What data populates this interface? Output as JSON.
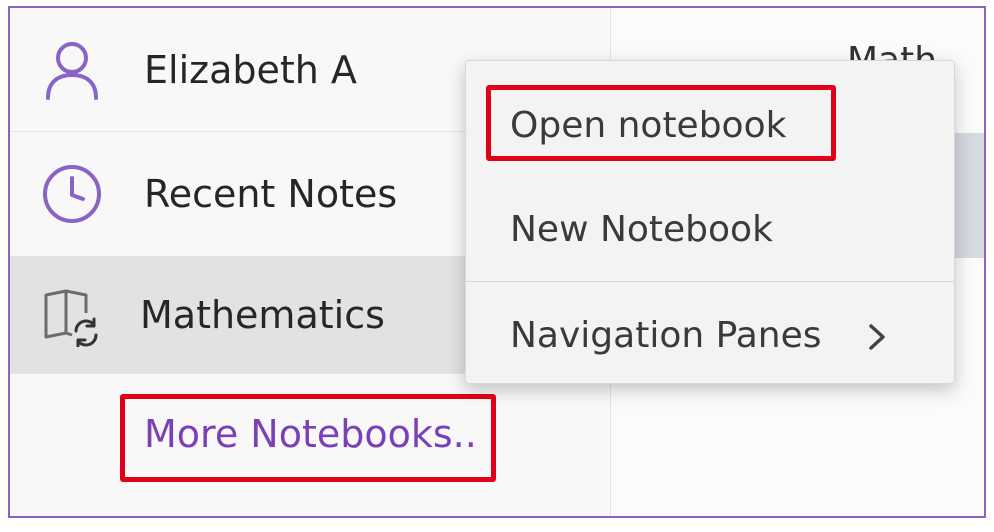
{
  "nav": {
    "user_name": "Elizabeth A",
    "recent_notes": "Recent Notes",
    "notebook_name": "Mathematics",
    "more_notebooks": "More Notebooks.."
  },
  "page": {
    "title_partial": "Math"
  },
  "context_menu": {
    "open_notebook": "Open notebook",
    "new_notebook": "New Notebook",
    "navigation_panes": "Navigation Panes"
  },
  "icons": {
    "user": "person-icon",
    "recent": "clock-icon",
    "notebook": "notebook-sync-icon",
    "submenu": "chevron-right-icon"
  },
  "colors": {
    "accent_purple": "#8a63c4",
    "link_purple": "#7b3fb8",
    "highlight_red": "#e1001a",
    "selected_row": "#e2e2e2"
  }
}
